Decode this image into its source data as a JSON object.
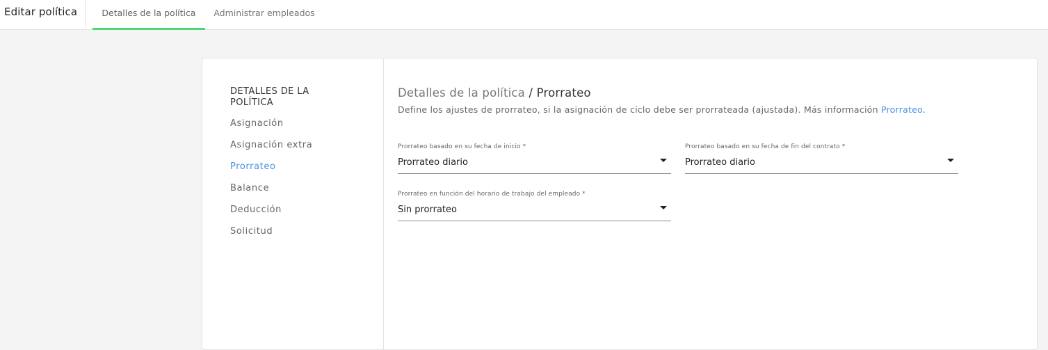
{
  "header": {
    "title": "Editar política",
    "tabs": [
      {
        "label": "Detalles de la política",
        "active": true
      },
      {
        "label": "Administrar empleados",
        "active": false
      }
    ],
    "accent_color": "#4fd675"
  },
  "sidebar": {
    "section_title": "DETALLES DE LA POLÍTICA",
    "items": [
      {
        "label": "Asignación",
        "active": false
      },
      {
        "label": "Asignación extra",
        "active": false
      },
      {
        "label": "Prorrateo",
        "active": true
      },
      {
        "label": "Balance",
        "active": false
      },
      {
        "label": "Deducción",
        "active": false
      },
      {
        "label": "Solicitud",
        "active": false
      }
    ],
    "active_color": "#4a90e2"
  },
  "main": {
    "breadcrumb_parent": "Detalles de la política",
    "breadcrumb_separator": " / ",
    "breadcrumb_current": "Prorrateo",
    "description": "Define los ajustes de prorrateo, si la asignación de ciclo debe ser prorrateada (ajustada). Más información ",
    "description_link": "Prorrateo",
    "description_end": ".",
    "fields": [
      {
        "label": "Prorrateo basado en su fecha de inicio *",
        "value": "Prorrateo diario",
        "icon": "caret-down-icon"
      },
      {
        "label": "Prorrateo basado en su fecha de fin del contrato *",
        "value": "Prorrateo diario",
        "icon": "caret-down-icon"
      },
      {
        "label": "Prorrateo en función del horario de trabajo del empleado *",
        "value": "Sin prorrateo",
        "icon": "caret-down-icon"
      }
    ]
  }
}
